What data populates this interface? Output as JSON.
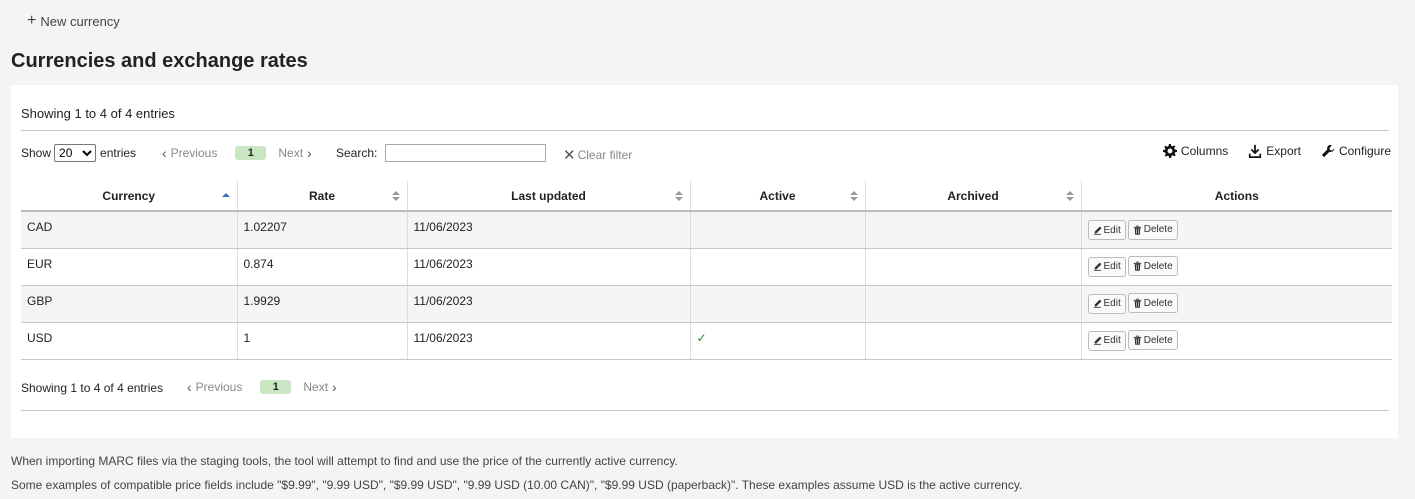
{
  "toolbar": {
    "new_currency_label": "New currency"
  },
  "page_title": "Currencies and exchange rates",
  "info": "Showing 1 to 4 of 4 entries",
  "length_menu": {
    "show_label": "Show",
    "selected": "20",
    "entries_label": "entries"
  },
  "pager": {
    "previous": "Previous",
    "current_page": "1",
    "next": "Next"
  },
  "search": {
    "label": "Search:",
    "value": ""
  },
  "clear_filter_label": "Clear filter",
  "tools": {
    "columns": "Columns",
    "export": "Export",
    "configure": "Configure"
  },
  "table": {
    "headers": [
      "Currency",
      "Rate",
      "Last updated",
      "Active",
      "Archived",
      "Actions"
    ],
    "sorted_column": "Currency",
    "rows": [
      {
        "currency": "CAD",
        "rate": "1.02207",
        "last_updated": "11/06/2023",
        "active": "",
        "archived": ""
      },
      {
        "currency": "EUR",
        "rate": "0.874",
        "last_updated": "11/06/2023",
        "active": "",
        "archived": ""
      },
      {
        "currency": "GBP",
        "rate": "1.9929",
        "last_updated": "11/06/2023",
        "active": "",
        "archived": ""
      },
      {
        "currency": "USD",
        "rate": "1",
        "last_updated": "11/06/2023",
        "active": "✓",
        "archived": ""
      }
    ],
    "edit_label": "Edit",
    "delete_label": "Delete"
  },
  "notes": [
    "When importing MARC files via the staging tools, the tool will attempt to find and use the price of the currently active currency.",
    "Some examples of compatible price fields include \"$9.99\", \"9.99 USD\", \"$9.99 USD\", \"9.99 USD (10.00 CAN)\", \"$9.99 USD (paperback)\". These examples assume USD is the active currency."
  ],
  "colors": {
    "page_bg": "#f3f4f4",
    "current_page_bg": "#c9e6c2",
    "check": "#2e8b2e",
    "sort_active": "#3a6fc4"
  }
}
